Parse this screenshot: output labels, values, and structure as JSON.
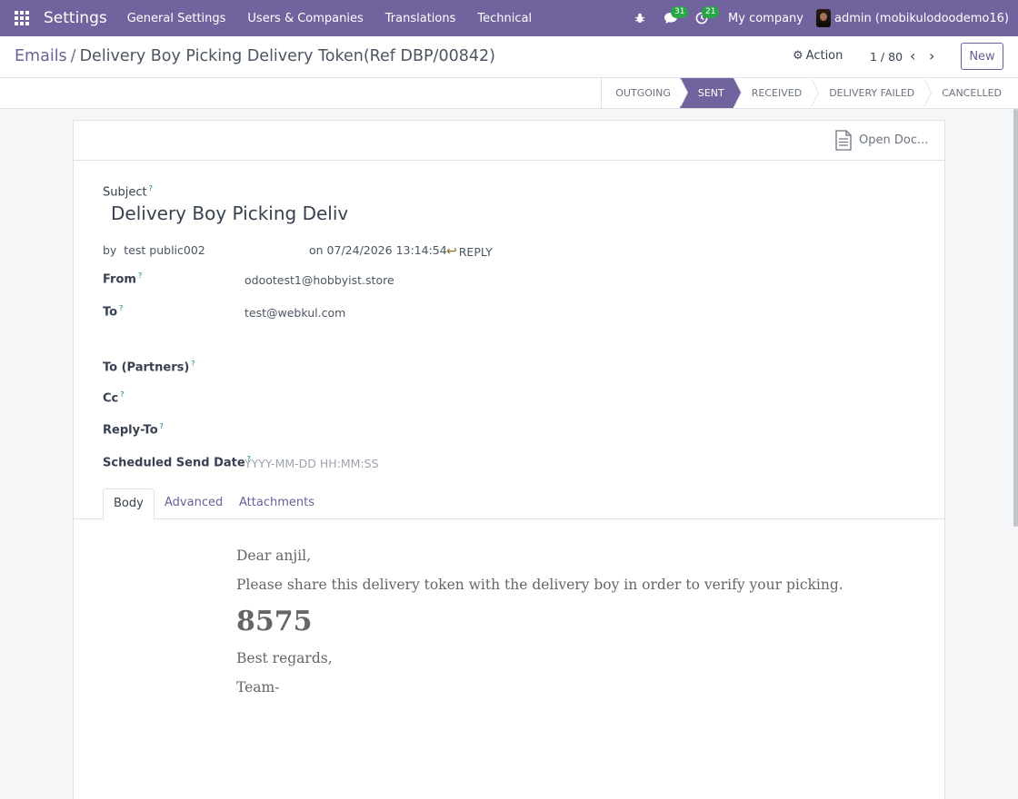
{
  "navbar": {
    "brand": "Settings",
    "menu": [
      "General Settings",
      "Users & Companies",
      "Translations",
      "Technical"
    ],
    "messages_count": "31",
    "activities_count": "21",
    "company": "My company",
    "user": "admin (mobikulodoodemo16)"
  },
  "control": {
    "breadcrumb_parent": "Emails",
    "breadcrumb_current": "Delivery Boy Picking Delivery Token(Ref DBP/00842)",
    "action_label": "Action",
    "pager": "1 / 80",
    "new_label": "New"
  },
  "stages": [
    {
      "label": "OUTGOING",
      "active": false
    },
    {
      "label": "SENT",
      "active": true
    },
    {
      "label": "RECEIVED",
      "active": false
    },
    {
      "label": "DELIVERY FAILED",
      "active": false
    },
    {
      "label": "CANCELLED",
      "active": false
    }
  ],
  "sheet": {
    "open_doc": "Open Doc...",
    "subject_label": "Subject",
    "subject_value": "Delivery Boy Picking Delivery",
    "by_prefix": "by",
    "author": "test public002",
    "date_line": "on 07/24/2026 13:14:54",
    "reply_label": "REPLY",
    "fields": {
      "from_label": "From",
      "from_value": "odootest1@hobbyist.store",
      "to_label": "To",
      "to_value": "test@webkul.com",
      "to_partners_label": "To (Partners)",
      "cc_label": "Cc",
      "reply_to_label": "Reply-To",
      "scheduled_label": "Scheduled Send Date",
      "scheduled_placeholder": "YYYY-MM-DD HH:MM:SS"
    },
    "help_mark": "?",
    "tabs": [
      "Body",
      "Advanced",
      "Attachments"
    ]
  },
  "body": {
    "greeting": "Dear anjil,",
    "message": "Please share this delivery token with the delivery boy in order to verify your picking.",
    "token": "8575",
    "closing": "Best regards,",
    "signature": "Team-"
  }
}
